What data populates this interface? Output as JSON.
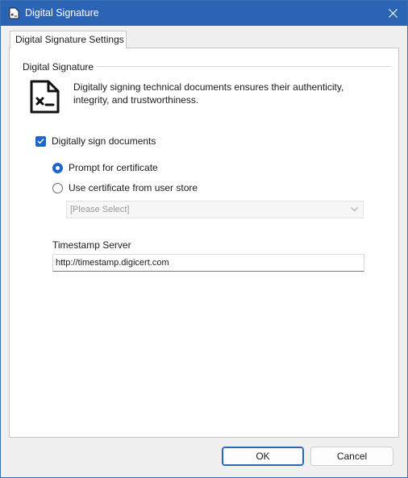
{
  "window": {
    "title": "Digital Signature",
    "accent_color": "#2a64b2"
  },
  "tabs": [
    {
      "label": "Digital Signature Settings",
      "selected": true
    }
  ],
  "group": {
    "label": "Digital Signature",
    "icon": "signed-document-icon",
    "description": "Digitally signing technical documents ensures their authenticity, integrity, and trustworthiness."
  },
  "sign_documents": {
    "label": "Digitally sign documents",
    "checked": true
  },
  "certificate_options": [
    {
      "label": "Prompt for certificate",
      "selected": true
    },
    {
      "label": "Use certificate from user store",
      "selected": false
    }
  ],
  "certificate_select": {
    "value": "[Please Select]",
    "enabled": false
  },
  "timestamp": {
    "label": "Timestamp Server",
    "value": "http://timestamp.digicert.com"
  },
  "buttons": {
    "ok": "OK",
    "cancel": "Cancel"
  }
}
